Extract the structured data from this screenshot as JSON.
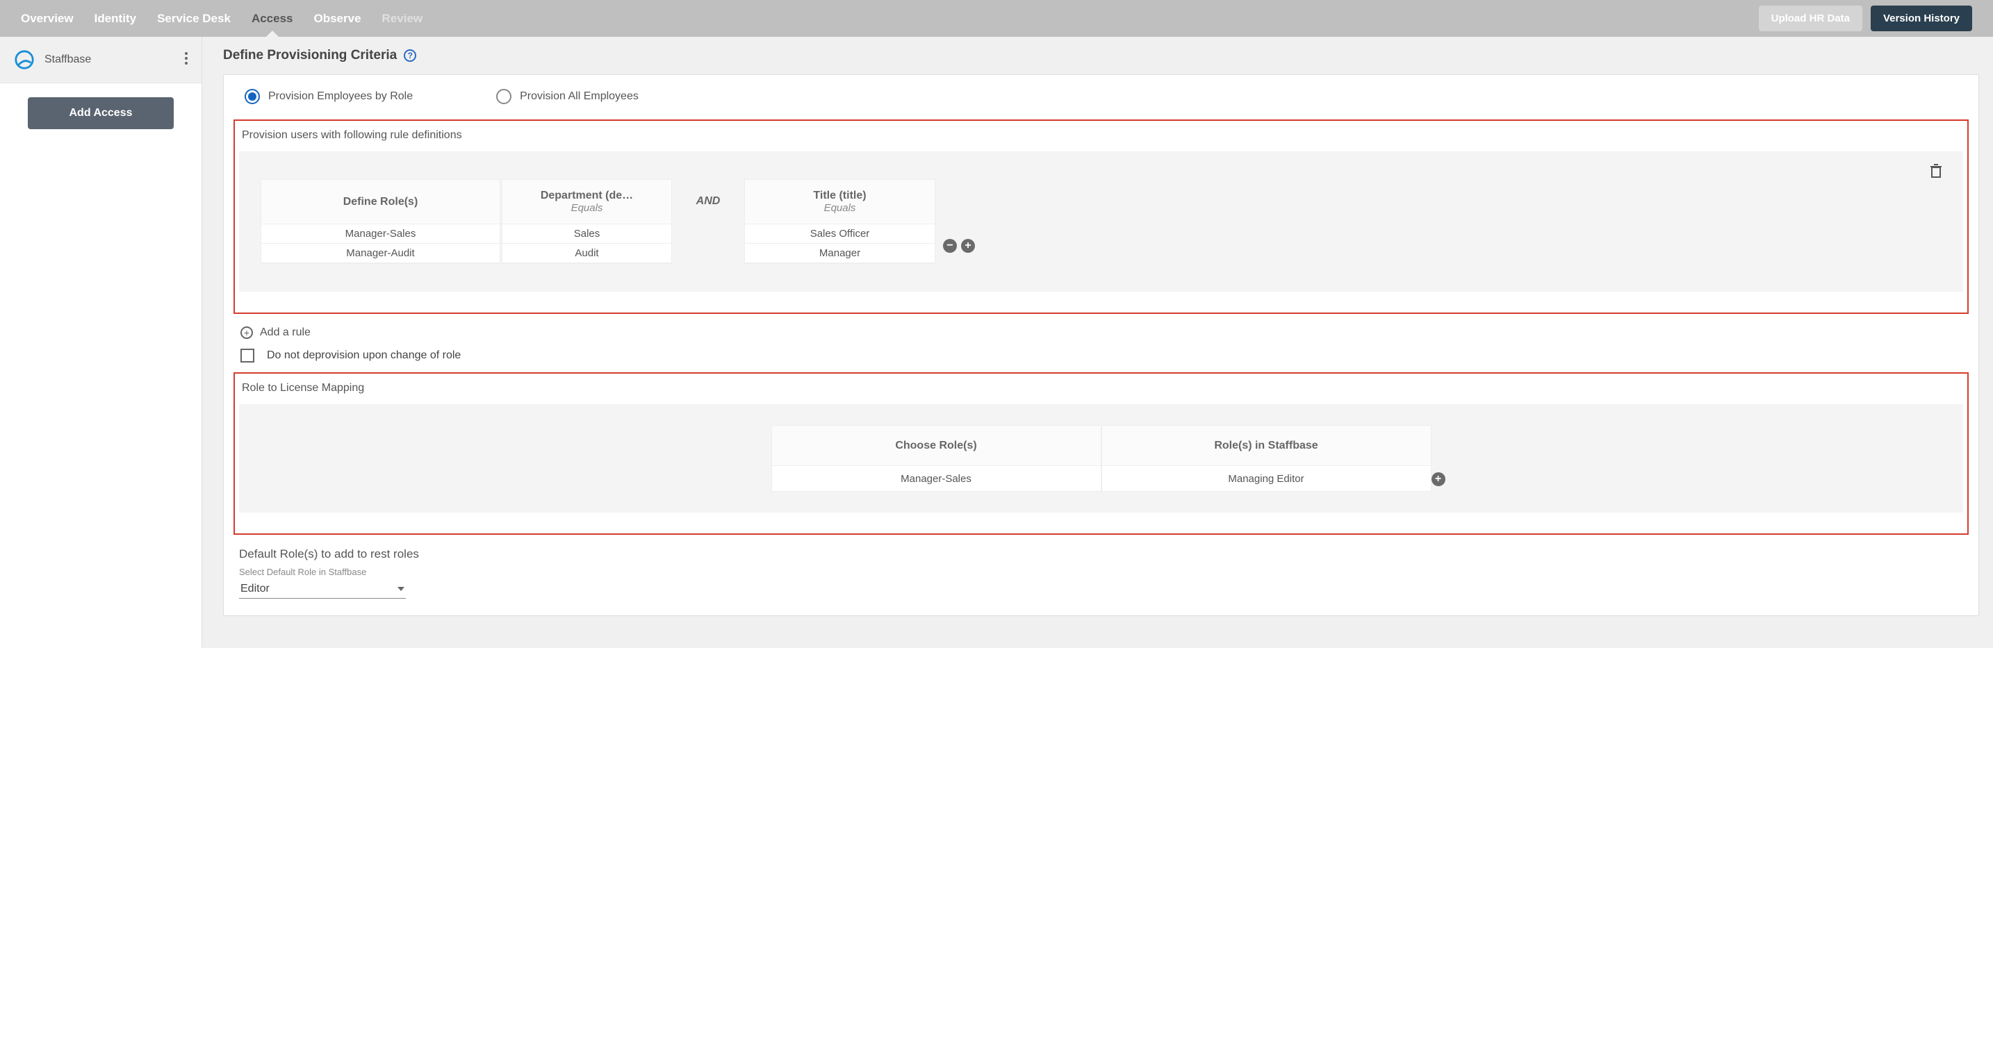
{
  "nav": {
    "tabs": [
      "Overview",
      "Identity",
      "Service Desk",
      "Access",
      "Observe",
      "Review"
    ],
    "active": "Access",
    "faded": "Review",
    "upload_btn": "Upload HR Data",
    "version_btn": "Version History"
  },
  "sidebar": {
    "app_name": "Staffbase",
    "add_access_btn": "Add Access"
  },
  "main": {
    "title": "Define Provisioning Criteria",
    "radio": {
      "by_role": "Provision Employees by Role",
      "all": "Provision All Employees"
    },
    "rules": {
      "section_label": "Provision users with following rule definitions",
      "headers": {
        "define_roles": "Define Role(s)",
        "department": "Department (de…",
        "dept_op": "Equals",
        "and": "AND",
        "title": "Title (title)",
        "title_op": "Equals"
      },
      "rows": [
        {
          "role": "Manager-Sales",
          "dept": "Sales",
          "title": "Sales Officer"
        },
        {
          "role": "Manager-Audit",
          "dept": "Audit",
          "title": "Manager"
        }
      ]
    },
    "add_rule_label": "Add a rule",
    "checkbox_label": "Do not deprovision upon change of role",
    "mapping": {
      "section_label": "Role to License Mapping",
      "headers": {
        "choose": "Choose Role(s)",
        "target": "Role(s) in Staffbase"
      },
      "rows": [
        {
          "choose": "Manager-Sales",
          "target": "Managing Editor"
        }
      ]
    },
    "default": {
      "label": "Default Role(s) to add to rest roles",
      "hint": "Select Default Role in Staffbase",
      "value": "Editor"
    }
  }
}
